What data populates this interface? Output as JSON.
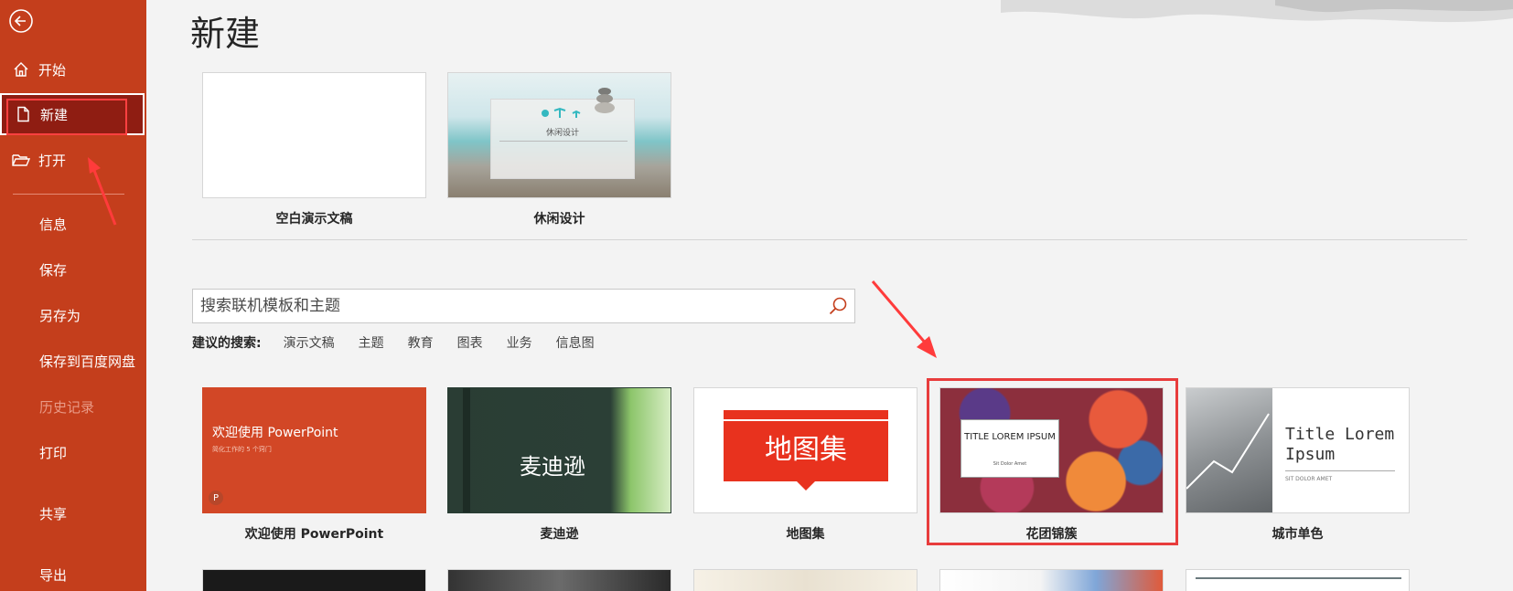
{
  "sidebar": {
    "items": [
      {
        "label": "开始"
      },
      {
        "label": "新建"
      },
      {
        "label": "打开"
      },
      {
        "label": "信息"
      },
      {
        "label": "保存"
      },
      {
        "label": "另存为"
      },
      {
        "label": "保存到百度网盘"
      },
      {
        "label": "历史记录"
      },
      {
        "label": "打印"
      },
      {
        "label": "共享"
      },
      {
        "label": "导出"
      }
    ]
  },
  "main": {
    "title": "新建",
    "top_templates": [
      {
        "caption": "空白演示文稿"
      },
      {
        "caption": "休闲设计",
        "thumb_text": "休闲设计"
      }
    ],
    "search": {
      "placeholder": "搜索联机模板和主题"
    },
    "suggested": {
      "label": "建议的搜索:",
      "tags": [
        "演示文稿",
        "主题",
        "教育",
        "图表",
        "业务",
        "信息图"
      ]
    },
    "templates": [
      {
        "caption": "欢迎使用 PowerPoint",
        "thumb_title": "欢迎使用 PowerPoint",
        "thumb_sub": "简化工作的 5 个窍门"
      },
      {
        "caption": "麦迪逊",
        "thumb_title": "麦迪逊"
      },
      {
        "caption": "地图集",
        "thumb_title": "地图集"
      },
      {
        "caption": "花团锦簇",
        "thumb_title": "TITLE LOREM IPSUM",
        "thumb_sub": "Sit Dolor Amet"
      },
      {
        "caption": "城市单色",
        "thumb_title": "Title Lorem Ipsum",
        "thumb_sub": "SIT DOLOR AMET"
      }
    ]
  },
  "colors": {
    "accent": "#c43e1c",
    "active": "#8f1d12",
    "annotation": "#e83c3c"
  }
}
